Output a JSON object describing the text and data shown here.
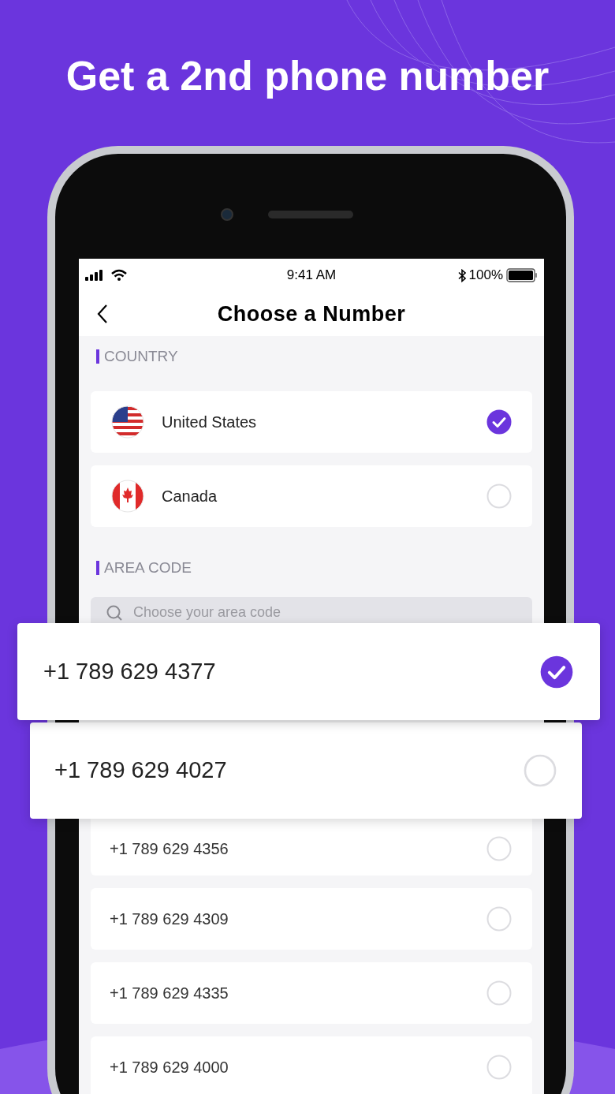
{
  "headline": "Get a 2nd phone number",
  "status_bar": {
    "time": "9:41 AM",
    "battery": "100%"
  },
  "title": "Choose a Number",
  "country_section": {
    "label": "COUNTRY",
    "countries": [
      {
        "name": "United States",
        "kind": "us",
        "selected": true
      },
      {
        "name": "Canada",
        "kind": "ca",
        "selected": false
      }
    ]
  },
  "area_code_section": {
    "label": "AREA CODE",
    "search": {
      "placeholder": "Choose your area code"
    }
  },
  "featured_numbers": [
    {
      "number": "+1 789 629 4377",
      "selected": true
    },
    {
      "number": "+1 789 629 4027",
      "selected": false
    }
  ],
  "numbers": [
    {
      "number": "+1 789 629 4356",
      "selected": false
    },
    {
      "number": "+1 789 629 4309",
      "selected": false
    },
    {
      "number": "+1 789 629 4335",
      "selected": false
    },
    {
      "number": "+1 789 629 4000",
      "selected": false
    }
  ]
}
